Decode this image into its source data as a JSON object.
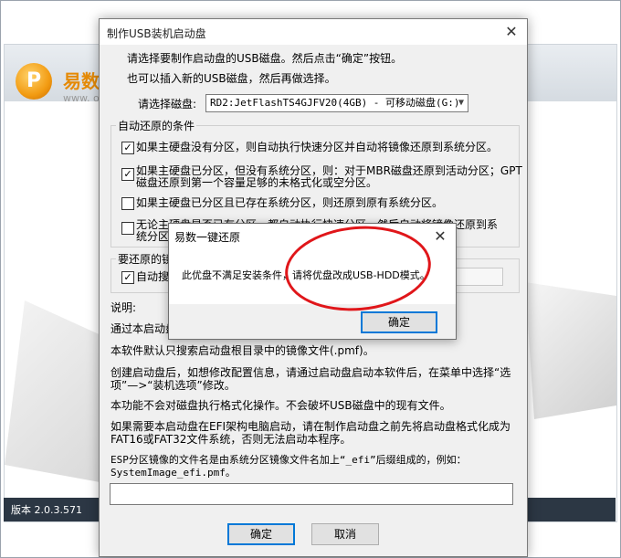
{
  "background_app": {
    "logo_glyph": "P",
    "name": "易数",
    "subtitle": "www. o",
    "version": "版本 2.0.3.571"
  },
  "dialog": {
    "title": "制作USB装机启动盘",
    "intro_line1": "请选择要制作启动盘的USB磁盘。然后点击“确定”按钮。",
    "intro_line2": "也可以插入新的USB磁盘，然后再做选择。",
    "disk_label": "请选择磁盘:",
    "disk_value": "RD2:JetFlashTS4GJFV20(4GB) - 可移动磁盘(G:)",
    "auto_restore_group": "自动还原的条件",
    "options": [
      {
        "checked": true,
        "line1": "如果主硬盘没有分区，则自动执行快速分区并自动将镜像还原到系统分区。",
        "line2": ""
      },
      {
        "checked": true,
        "line1": "如果主硬盘已分区，但没有系统分区，则：对于MBR磁盘还原到活动分区；GPT",
        "line2": "磁盘还原到第一个容量足够的未格式化或空分区。"
      },
      {
        "checked": false,
        "line1": "如果主硬盘已分区且已存在系统分区，则还原到原有系统分区。",
        "line2": ""
      },
      {
        "checked": false,
        "line1": "无论主硬盘是否已有分区，都自动执行快速分区，然后自动将镜像还原到系",
        "line2": "统分区。"
      }
    ],
    "image_group": "要还原的镜",
    "auto_search_label": "自动搜",
    "notes_title": "说明:",
    "notes": [
      "通过本启动盘",
      "本软件默认只搜索启动盘根目录中的镜像文件(.pmf)。",
      "创建启动盘后，如想修改配置信息，请通过启动盘启动本软件后，在菜单中选择“选",
      "项”—>“装机选项”修改。",
      "本功能不会对磁盘执行格式化操作。不会破坏USB磁盘中的现有文件。",
      "如果需要本启动盘在EFI架构电脑启动，请在制作启动盘之前先将启动盘格式化成为",
      "FAT16或FAT32文件系统，否则无法启动本程序。",
      "ESP分区镜像的文件名是由系统分区镜像文件名加上“_efi”后缀组成的，例如：",
      "SystemImage_efi.pmf。"
    ],
    "ok_label": "确定",
    "cancel_label": "取消",
    "close_glyph": "✕"
  },
  "message_box": {
    "title": "易数一键还原",
    "text": "此优盘不满足安装条件，请将优盘改成USB-HDD模式。",
    "ok_label": "确定",
    "close_glyph": "✕"
  },
  "colors": {
    "annotation_ring": "#e0161a",
    "brand_orange": "#e58a06",
    "focus_blue": "#0078d7"
  }
}
